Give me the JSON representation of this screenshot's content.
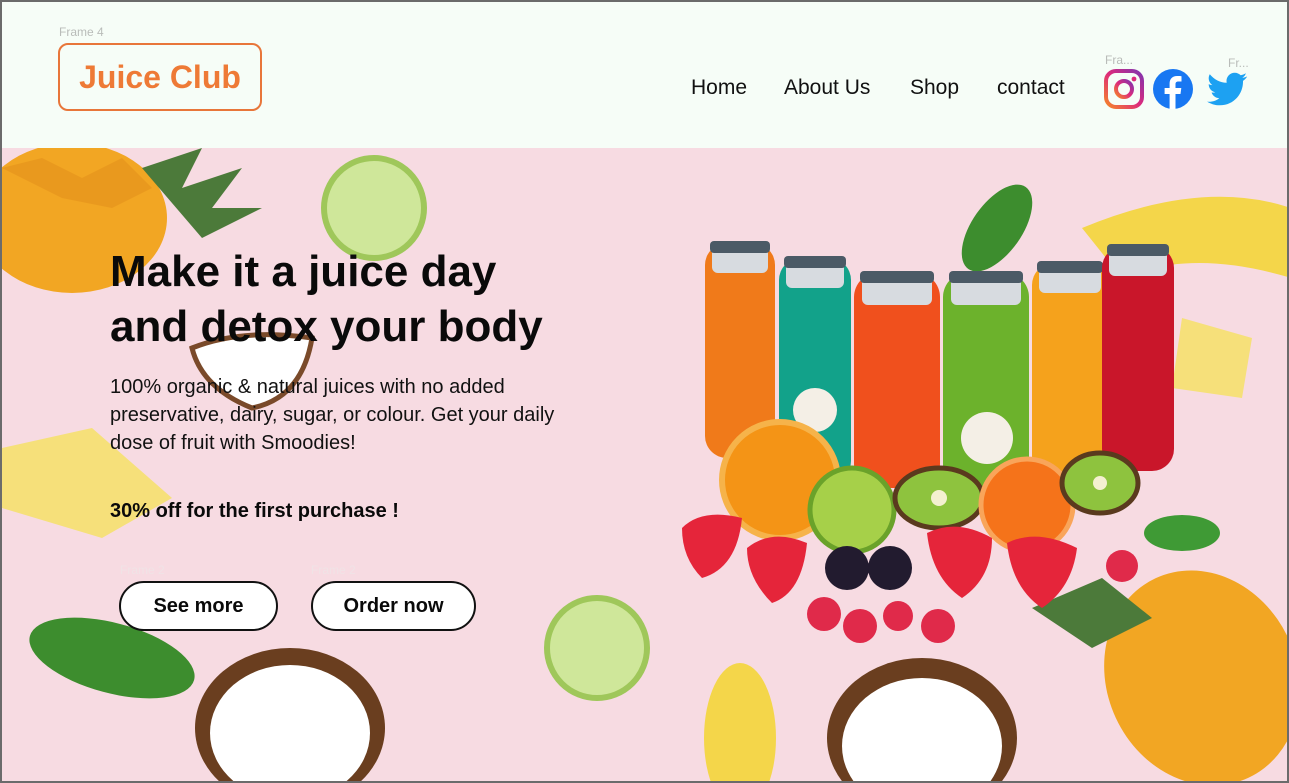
{
  "frames": {
    "header_tag": "Frame 4",
    "instagram_tag": "Fra...",
    "twitter_tag": "Fr...",
    "see_more_tag": "Frame 2",
    "order_now_tag": "Frame 2"
  },
  "brand": {
    "name": "Juice Club",
    "color": "#ee7a36"
  },
  "nav": {
    "items": [
      "Home",
      "About Us",
      "Shop",
      "contact"
    ]
  },
  "social": {
    "icons": [
      "instagram-icon",
      "facebook-icon",
      "twitter-icon"
    ],
    "colors": {
      "instagram": "#e1306c",
      "facebook": "#1877f2",
      "twitter": "#1da1f2"
    }
  },
  "hero": {
    "headline_line1": "Make it a juice day",
    "headline_line2": "and detox your body",
    "description": "100% organic & natural juices with no added preservative, dairy, sugar, or colour. Get your daily dose of fruit with Smoodies!",
    "offer": "30% off for the first purchase !",
    "buttons": {
      "see_more": "See more",
      "order_now": "Order now"
    },
    "background_color": "#f7dbe2"
  }
}
